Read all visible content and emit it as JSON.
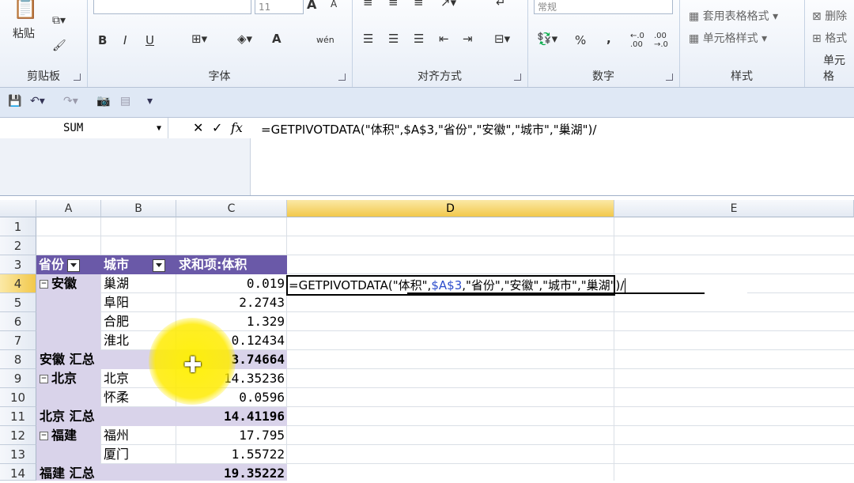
{
  "ribbon": {
    "clipboard": {
      "label": "剪贴板",
      "paste": "粘贴"
    },
    "font": {
      "label": "字体",
      "size": "11",
      "bold": "B",
      "italic": "I",
      "underline": "U",
      "grow": "A",
      "shrink": "A",
      "fontcolor": "A",
      "phonetic": "wén"
    },
    "alignment": {
      "label": "对齐方式"
    },
    "number": {
      "label": "数字",
      "format": "常规",
      "percent": "%",
      "comma": ",",
      "inc_decimal": "←.0 .00",
      "dec_decimal": ".00 →.0"
    },
    "styles": {
      "label": "样式",
      "table_format": "套用表格格式",
      "cell_styles": "单元格样式"
    },
    "cells": {
      "label": "单元格",
      "delete": "删除",
      "format": "格式"
    }
  },
  "formula_bar": {
    "name_box": "SUM",
    "cancel": "✕",
    "enter": "✓",
    "fx": "fx",
    "formula": "=GETPIVOTDATA(\"体积\",$A$3,\"省份\",\"安徽\",\"城市\",\"巢湖\")/"
  },
  "columns": [
    "A",
    "B",
    "C",
    "D",
    "E"
  ],
  "rows": [
    "1",
    "2",
    "3",
    "4",
    "5",
    "6",
    "7",
    "8",
    "9",
    "10",
    "11",
    "12",
    "13",
    "14"
  ],
  "pivot": {
    "header": {
      "province": "省份",
      "city": "城市",
      "sum": "求和项:体积"
    },
    "r4": {
      "province": "安徽",
      "city": "巢湖",
      "value": "0.019"
    },
    "r5": {
      "city": "阜阳",
      "value": "2.2743"
    },
    "r6": {
      "city": "合肥",
      "value": "1.329"
    },
    "r7": {
      "city": "淮北",
      "value": "0.12434"
    },
    "r8": {
      "label": "安徽 汇总",
      "value": "3.74664"
    },
    "r9": {
      "province": "北京",
      "city": "北京",
      "value": "14.35236"
    },
    "r10": {
      "city": "怀柔",
      "value": "0.0596"
    },
    "r11": {
      "label": "北京 汇总",
      "value": "14.41196"
    },
    "r12": {
      "province": "福建",
      "city": "福州",
      "value": "17.795"
    },
    "r13": {
      "city": "厦门",
      "value": "1.55722"
    },
    "r14": {
      "label": "福建 汇总",
      "value": "19.35222"
    }
  },
  "editing": {
    "part1": "=GETPIVOTDATA(\"体积\",",
    "ref": "$A$3",
    "part2": ",\"省份\",\"安徽\",\"城市\",\"巢湖\")/"
  }
}
